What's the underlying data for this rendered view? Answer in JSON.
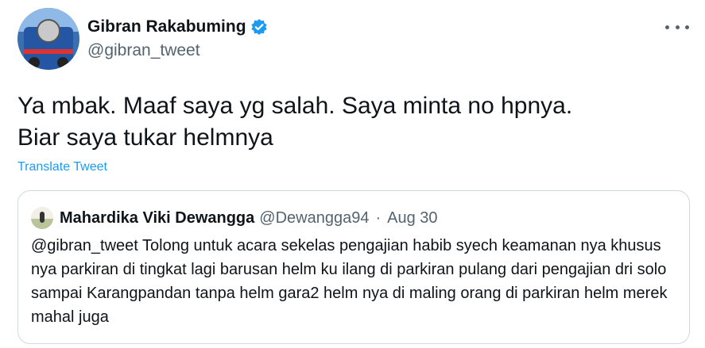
{
  "author": {
    "display_name": "Gibran Rakabuming",
    "handle": "@gibran_tweet",
    "verified": true
  },
  "tweet": {
    "text": "Ya mbak. Maaf saya yg salah. Saya minta no hpnya.\nBiar saya tukar helmnya",
    "translate_label": "Translate Tweet"
  },
  "quoted": {
    "display_name": "Mahardika Viki Dewangga",
    "handle": "@Dewangga94",
    "separator": "·",
    "date": "Aug 30",
    "text": "@gibran_tweet Tolong untuk acara sekelas pengajian habib syech keamanan nya khusus nya parkiran di tingkat lagi barusan helm ku ilang di parkiran pulang dari pengajian dri solo sampai Karangpandan tanpa helm gara2 helm nya di maling orang di parkiran helm merek mahal juga"
  },
  "icons": {
    "verified": "verified-badge-icon",
    "more": "more-options-icon"
  },
  "colors": {
    "accent": "#1d9bf0",
    "secondary_text": "#536471",
    "border": "#cfd9de"
  }
}
